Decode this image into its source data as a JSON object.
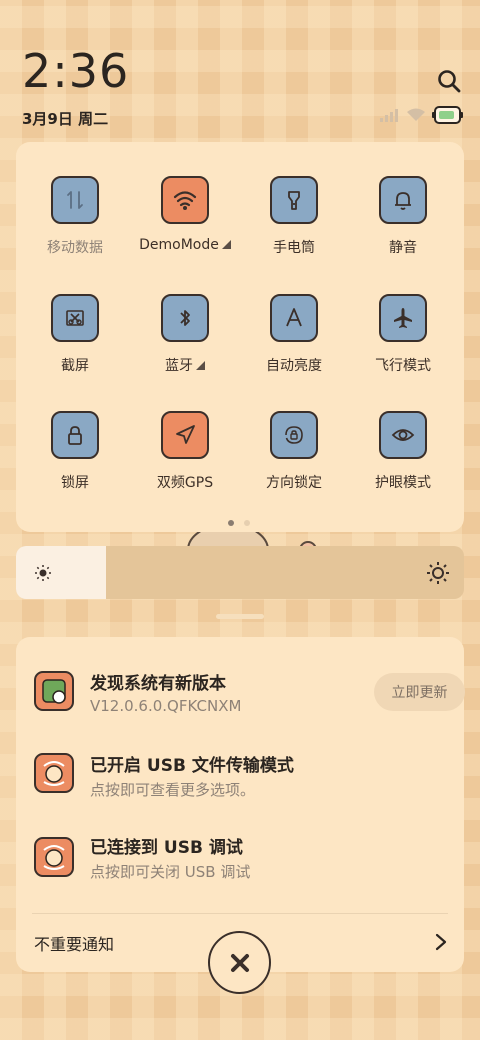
{
  "status_bar": {
    "time": "2:36",
    "date": "3月9日 周二"
  },
  "quick_settings": {
    "tiles": [
      {
        "label": "移动数据",
        "color": "blue",
        "icon": "mobile-data-icon",
        "dim": true
      },
      {
        "label": "DemoMode",
        "color": "orange",
        "icon": "wifi-icon",
        "dropdown": true
      },
      {
        "label": "手电筒",
        "color": "blue",
        "icon": "flashlight-icon"
      },
      {
        "label": "静音",
        "color": "blue",
        "icon": "bell-icon"
      },
      {
        "label": "截屏",
        "color": "blue",
        "icon": "screenshot-icon"
      },
      {
        "label": "蓝牙",
        "color": "blue",
        "icon": "bluetooth-icon",
        "dropdown": true
      },
      {
        "label": "自动亮度",
        "color": "blue",
        "icon": "auto-brightness-icon"
      },
      {
        "label": "飞行模式",
        "color": "blue",
        "icon": "airplane-icon"
      },
      {
        "label": "锁屏",
        "color": "blue",
        "icon": "lock-icon"
      },
      {
        "label": "双频GPS",
        "color": "orange",
        "icon": "location-icon"
      },
      {
        "label": "方向锁定",
        "color": "blue",
        "icon": "rotation-lock-icon"
      },
      {
        "label": "护眼模式",
        "color": "blue",
        "icon": "eye-icon"
      }
    ],
    "page_count": 2,
    "active_page": 1
  },
  "brightness": {
    "level": 0.2
  },
  "notifications": {
    "items": [
      {
        "title": "发现系统有新版本",
        "subtitle": "V12.0.6.0.QFKCNXM",
        "action": "立即更新"
      },
      {
        "title": "已开启 USB 文件传输模式",
        "subtitle": "点按即可查看更多选项。"
      },
      {
        "title": "已连接到 USB 调试",
        "subtitle": "点按即可关闭 USB 调试"
      }
    ],
    "unimportant_label": "不重要通知"
  },
  "colors": {
    "tile_blue": "#8aa8c4",
    "tile_orange": "#ec8c62",
    "panel_bg": "#fde6c4",
    "outline": "#3a2f2a"
  }
}
